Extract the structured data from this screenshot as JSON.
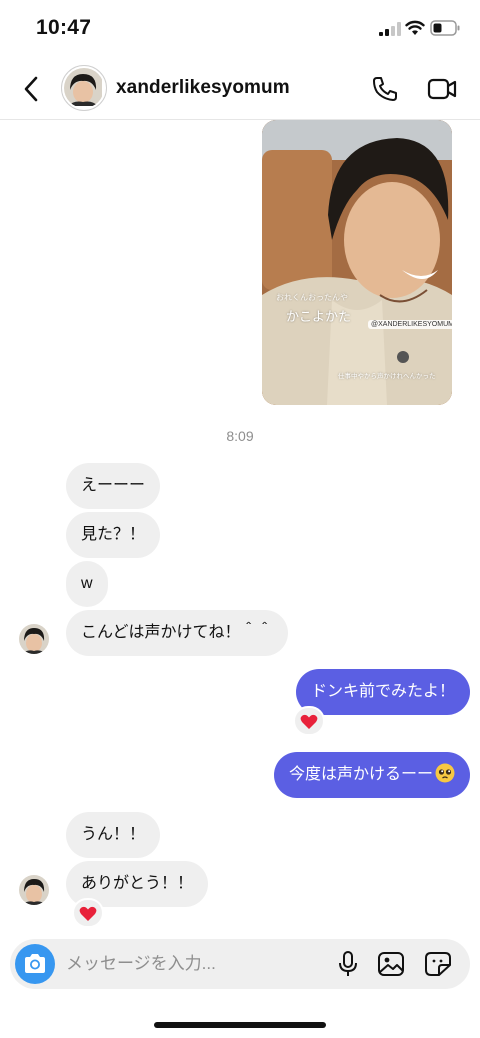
{
  "status_bar": {
    "time": "10:47"
  },
  "header": {
    "username": "xanderlikesyomum"
  },
  "shared_story": {
    "caption_small": "おれくんおったんや",
    "caption_main": "かこよかた",
    "mention": "@XANDERLIKESYOMUM",
    "caption_bottom": "仕事中やから声かけれへんかった"
  },
  "timestamp": "8:09",
  "messages": [
    {
      "text": "えーーー"
    },
    {
      "text": "見た？！"
    },
    {
      "text": "w"
    },
    {
      "text": "こんどは声かけてね！＾＾"
    },
    {
      "text": "ドンキ前でみたよ！"
    },
    {
      "text": "今度は声かけるーー"
    },
    {
      "text": "うん！！"
    },
    {
      "text": "ありがとう！！"
    }
  ],
  "composer": {
    "placeholder": "メッセージを入力..."
  },
  "colors": {
    "sent_bubble": "#5b5fe3",
    "received_bubble": "#efefef",
    "camera_button": "#3797f0",
    "heart": "#e8213a"
  }
}
